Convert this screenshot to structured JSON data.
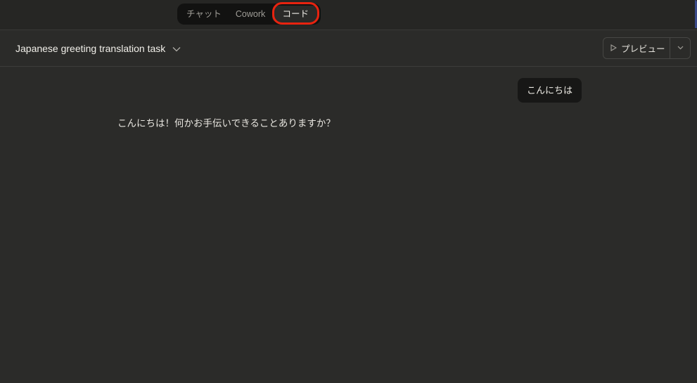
{
  "mode_tabs": [
    {
      "label": "チャット"
    },
    {
      "label": "Cowork"
    },
    {
      "label": "コード"
    }
  ],
  "header": {
    "title": "Japanese greeting translation task",
    "preview_label": "プレビュー"
  },
  "messages": {
    "user": "こんにちは",
    "assistant": "こんにちは！何かお手伝いできることありますか？"
  }
}
